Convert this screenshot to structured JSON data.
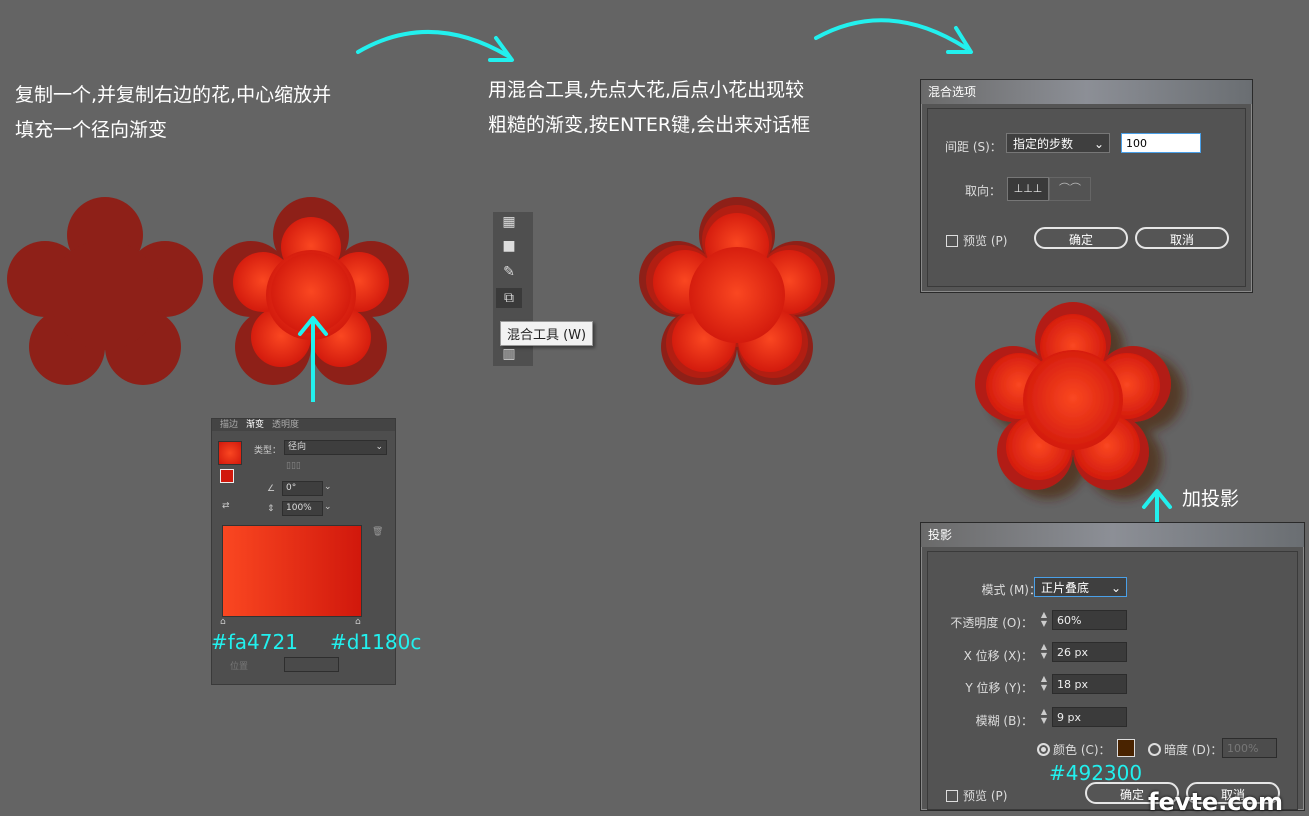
{
  "captions": {
    "step1_line1": "复制一个,并复制右边的花,中心缩放并",
    "step1_line2": "填充一个径向渐变",
    "step2_line1": "用混合工具,先点大花,后点小花出现较",
    "step2_line2": "粗糙的渐变,按ENTER键,会出来对话框",
    "shadow_label": "加投影"
  },
  "gradient_panel": {
    "tabs": [
      "描边",
      "渐变",
      "透明度"
    ],
    "type_label": "类型：",
    "type_value": "径向",
    "angle_value": "0°",
    "aspect_value": "100%",
    "position_label": "位置",
    "stop_left_hex": "#fa4721",
    "stop_right_hex": "#d1180c"
  },
  "toolbar": {
    "tooltip": "混合工具 (W)",
    "icons": [
      "mesh-tool-icon",
      "gradient-tool-icon",
      "eyedropper-tool-icon",
      "blend-tool-icon",
      "chart-tool-icon"
    ]
  },
  "blend_dialog": {
    "title": "混合选项",
    "spacing_label": "间距 (S)：",
    "spacing_value": "指定的步数",
    "steps_value": "100",
    "orientation_label": "取向：",
    "preview_label": "预览 (P)",
    "ok_label": "确定",
    "cancel_label": "取消"
  },
  "shadow_dialog": {
    "title": "投影",
    "mode_label": "模式 (M)：",
    "mode_value": "正片叠底",
    "opacity_label": "不透明度 (O)：",
    "opacity_value": "60%",
    "x_label": "X 位移 (X)：",
    "x_value": "26 px",
    "y_label": "Y 位移 (Y)：",
    "y_value": "18 px",
    "blur_label": "模糊 (B)：",
    "blur_value": "9 px",
    "color_label": "颜色 (C)：",
    "darkness_label": "暗度 (D)：",
    "darkness_value": "100%",
    "color_hex": "#492300",
    "preview_label": "预览 (P)",
    "ok_label": "确定",
    "cancel_label": "取消"
  },
  "watermark": "fevte.com",
  "colors": {
    "background": "#646464",
    "flower_dark": "#8e2018",
    "gradient_start": "#fa4721",
    "gradient_end": "#d1180c",
    "arrow": "#22f0ee",
    "shadow_color": "#492300"
  }
}
